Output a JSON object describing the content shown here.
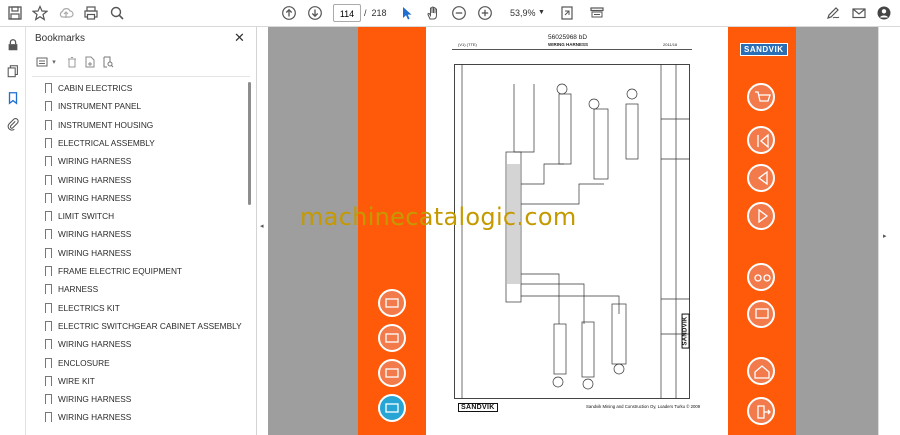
{
  "toolbar": {
    "page_current": "114",
    "page_separator": "/",
    "page_total": "218",
    "zoom": "53,9%"
  },
  "bookmarks": {
    "title": "Bookmarks",
    "items": [
      "CABIN ELECTRICS",
      "INSTRUMENT PANEL",
      "INSTRUMENT HOUSING",
      "ELECTRICAL ASSEMBLY",
      "WIRING HARNESS",
      "WIRING HARNESS",
      "WIRING HARNESS",
      "LIMIT SWITCH",
      "WIRING HARNESS",
      "WIRING HARNESS",
      "FRAME ELECTRIC EQUIPMENT",
      "HARNESS",
      "ELECTRICS KIT",
      "ELECTRIC SWITCHGEAR CABINET ASSEMBLY",
      "WIRING HARNESS",
      "ENCLOSURE",
      "WIRE KIT",
      "WIRING HARNESS",
      "WIRING HARNESS"
    ]
  },
  "document": {
    "part_number": "56025968 bD",
    "left_code": "(V1) (TTE)",
    "subtitle": "WIRING HARNESS",
    "right_code": "2011/16",
    "brand_top": "SANDVIK",
    "brand_bottom": "SANDVIK",
    "brand_side": "SANDVIK",
    "footer": "Sandvik Mining and Construction Oy, Loaders Turku © 2009"
  },
  "watermark": "machinecatalogic.com",
  "colors": {
    "band": "#ff5a0a",
    "orange_button": "#f27a4b",
    "blue_button": "#27a6d6",
    "viewer_bg": "#9e9e9e",
    "watermark": "#c49a00"
  }
}
